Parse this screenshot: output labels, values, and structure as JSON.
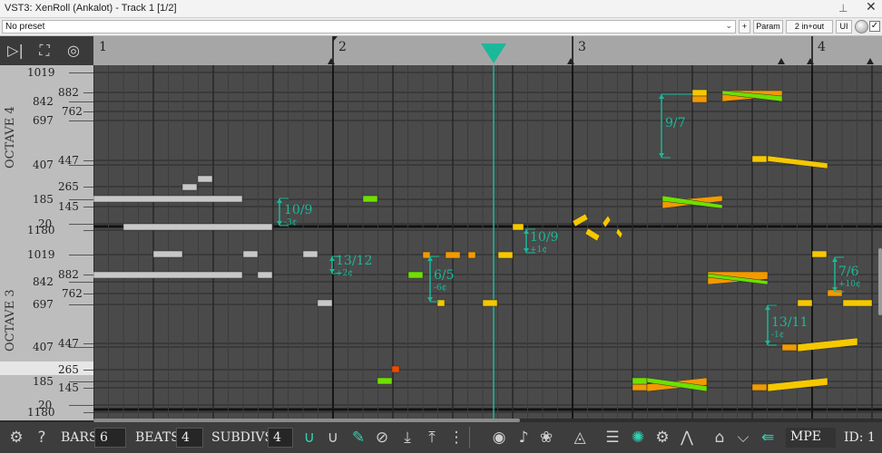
{
  "window": {
    "title": "VST3: XenRoll (Ankalot) - Track 1 [1/2]",
    "pin_icon": "pin-icon",
    "close_icon": "close-icon"
  },
  "plugin_bar": {
    "preset": "No preset",
    "plus_label": "+",
    "param_label": "Param",
    "io_label": "2 in+out",
    "ui_label": "UI",
    "check_label": "✓"
  },
  "timeline": {
    "bars": [
      "1",
      "2",
      "3",
      "4"
    ]
  },
  "keyboard": {
    "octave_labels": [
      "OCTAVE 4",
      "OCTAVE 3"
    ],
    "pitch_labels_upper": [
      "1019",
      "882",
      "842",
      "762",
      "697",
      "447",
      "407",
      "265",
      "185",
      "145",
      "20",
      "1180"
    ],
    "pitch_labels_lower": [
      "1019",
      "882",
      "842",
      "762",
      "697",
      "447",
      "407",
      "265",
      "185",
      "145",
      "20",
      "1180"
    ]
  },
  "intervals": [
    {
      "ratio": "10/9",
      "cents": "-3¢"
    },
    {
      "ratio": "13/12",
      "cents": "+2¢"
    },
    {
      "ratio": "6/5",
      "cents": "-6¢"
    },
    {
      "ratio": "10/9",
      "cents": "+1¢"
    },
    {
      "ratio": "9/7",
      "cents": ""
    },
    {
      "ratio": "7/6",
      "cents": "+10¢"
    },
    {
      "ratio": "13/11",
      "cents": "-1¢"
    }
  ],
  "bottom_bar": {
    "bars_label": "BARS",
    "bars_value": "6",
    "beats_label": "BEATS",
    "beats_value": "4",
    "subdivs_label": "SUBDIVS",
    "subdivs_value": "4",
    "mode_label": "MPE",
    "id_label": "ID: 1"
  },
  "colors": {
    "accent": "#1bb89a",
    "note_gray": "#c8c8c8",
    "note_yellow": "#f5c800",
    "note_orange": "#f39a00",
    "note_green": "#6ee000",
    "note_red": "#f04a00"
  }
}
